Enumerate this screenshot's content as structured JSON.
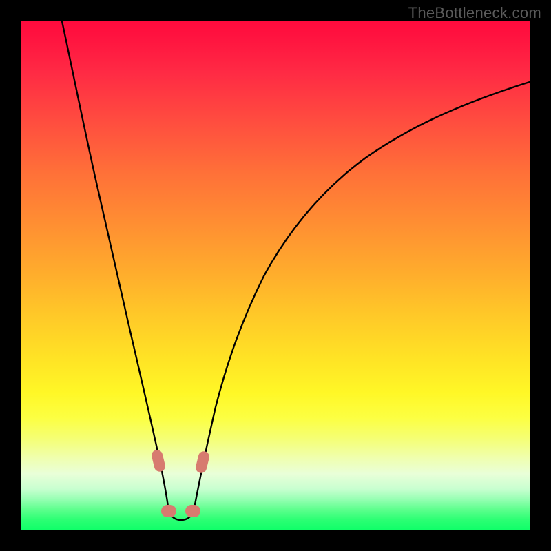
{
  "watermark": "TheBottleneck.com",
  "chart_data": {
    "type": "line",
    "title": "",
    "xlabel": "",
    "ylabel": "",
    "xlim": [
      0,
      100
    ],
    "ylim": [
      0,
      100
    ],
    "grid": false,
    "legend": false,
    "background": "rainbow-gradient (red→yellow→green)",
    "series": [
      {
        "name": "bottleneck-curve",
        "x": [
          8,
          10,
          12,
          14,
          16,
          18,
          20,
          22,
          24,
          26,
          27,
          28,
          29,
          30,
          31,
          32,
          34,
          36,
          38,
          40,
          44,
          48,
          52,
          56,
          60,
          66,
          72,
          80,
          90,
          100
        ],
        "y": [
          100,
          91,
          82,
          74,
          66,
          58,
          50,
          42,
          33,
          21,
          15,
          8,
          3,
          2,
          2,
          4,
          12,
          22,
          30,
          36,
          47,
          55,
          61,
          66,
          70,
          75,
          78,
          82,
          86,
          88
        ]
      }
    ],
    "annotations": [
      {
        "type": "highlight-blobs",
        "color": "#d77b6f",
        "near_x": [
          26,
          27,
          31,
          32
        ],
        "near_y_pct_from_top": [
          86,
          98,
          98,
          86
        ]
      }
    ]
  }
}
